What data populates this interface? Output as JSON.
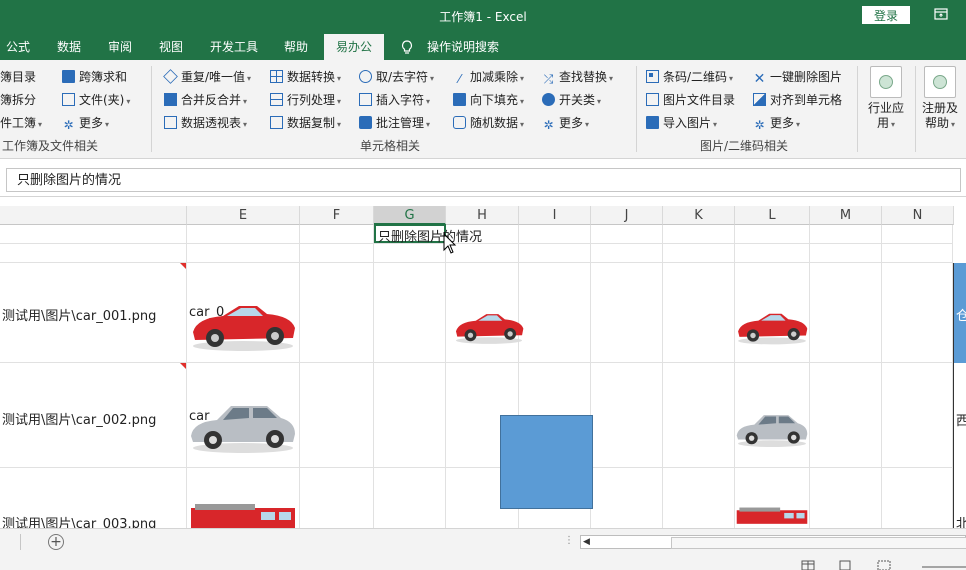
{
  "window": {
    "title": "工作簿1  -  Excel",
    "login_label": "登录"
  },
  "tabs": [
    {
      "label": "公式"
    },
    {
      "label": "数据"
    },
    {
      "label": "审阅"
    },
    {
      "label": "视图"
    },
    {
      "label": "开发工具"
    },
    {
      "label": "帮助"
    },
    {
      "label": "易办公"
    },
    {
      "label": "操作说明搜索"
    }
  ],
  "ribbon": {
    "group1": {
      "items": [
        "簿目录",
        "簿拆分",
        "件工簿"
      ],
      "more_items": [
        "跨簿求和",
        "文件(夹)",
        "更多"
      ],
      "label": "工作簿及文件相关"
    },
    "group2": {
      "col1": [
        "重复/唯一值",
        "合并反合并",
        "数据透视表"
      ],
      "col2": [
        "数据转换",
        "行列处理",
        "数据复制"
      ],
      "col3": [
        "取/去字符",
        "插入字符",
        "批注管理"
      ],
      "col4": [
        "加减乘除",
        "向下填充",
        "随机数据"
      ],
      "col5": [
        "查找替换",
        "开关类",
        "更多"
      ],
      "label": "单元格相关"
    },
    "group3": {
      "col1": [
        "条码/二维码",
        "图片文件目录",
        "导入图片"
      ],
      "col2": [
        "一键删除图片",
        "对齐到单元格",
        "更多"
      ],
      "label": "图片/二维码相关"
    },
    "big_buttons": [
      {
        "line1": "行业应",
        "line2": "用"
      },
      {
        "line1": "注册及",
        "line2": "帮助"
      }
    ]
  },
  "formula_bar": {
    "value": "只删除图片的情况"
  },
  "grid": {
    "columns": [
      "E",
      "F",
      "G",
      "H",
      "I",
      "J",
      "K",
      "L",
      "M",
      "N"
    ],
    "selected_column": "G",
    "cell_g1": "只删除图片的情况",
    "rows": [
      {
        "path": "测试用\\图片\\car_001.png",
        "e_label": "car_0",
        "right": "仓"
      },
      {
        "path": "测试用\\图片\\car_002.png",
        "e_label": "car",
        "right": "西"
      },
      {
        "path": "测试用\\图片\\car_003.png",
        "e_label": "",
        "right": "北"
      }
    ]
  },
  "colors": {
    "brand": "#217346",
    "shape": "#5b9bd5"
  }
}
